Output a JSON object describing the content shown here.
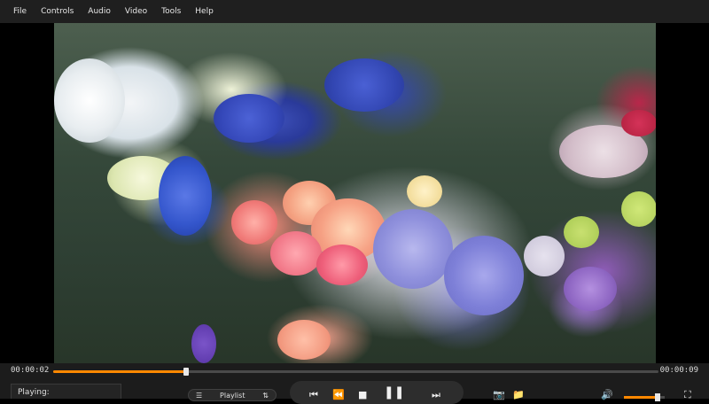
{
  "menu": {
    "items": [
      {
        "label": "File"
      },
      {
        "label": "Controls"
      },
      {
        "label": "Audio"
      },
      {
        "label": "Video"
      },
      {
        "label": "Tools"
      },
      {
        "label": "Help"
      }
    ]
  },
  "playback": {
    "current_time": "00:00:02",
    "total_time": "00:00:09",
    "progress_fraction": 0.22,
    "status_label": "Playing:"
  },
  "playlist": {
    "label": "Playlist"
  },
  "volume": {
    "level_fraction": 0.82
  },
  "icons": {
    "playlist": "list-icon",
    "playlist_sort": "sort-icon",
    "prev": "skip-previous-icon",
    "rewind": "rewind-icon",
    "stop": "stop-icon",
    "pause": "pause-icon",
    "next": "skip-next-icon",
    "snapshot": "camera-icon",
    "open_folder": "folder-icon",
    "volume": "speaker-icon",
    "fullscreen": "fullscreen-icon"
  },
  "colors": {
    "accent": "#ff8800",
    "bar_background": "#1c1c1c",
    "menubar_background": "#1f1f1f"
  }
}
